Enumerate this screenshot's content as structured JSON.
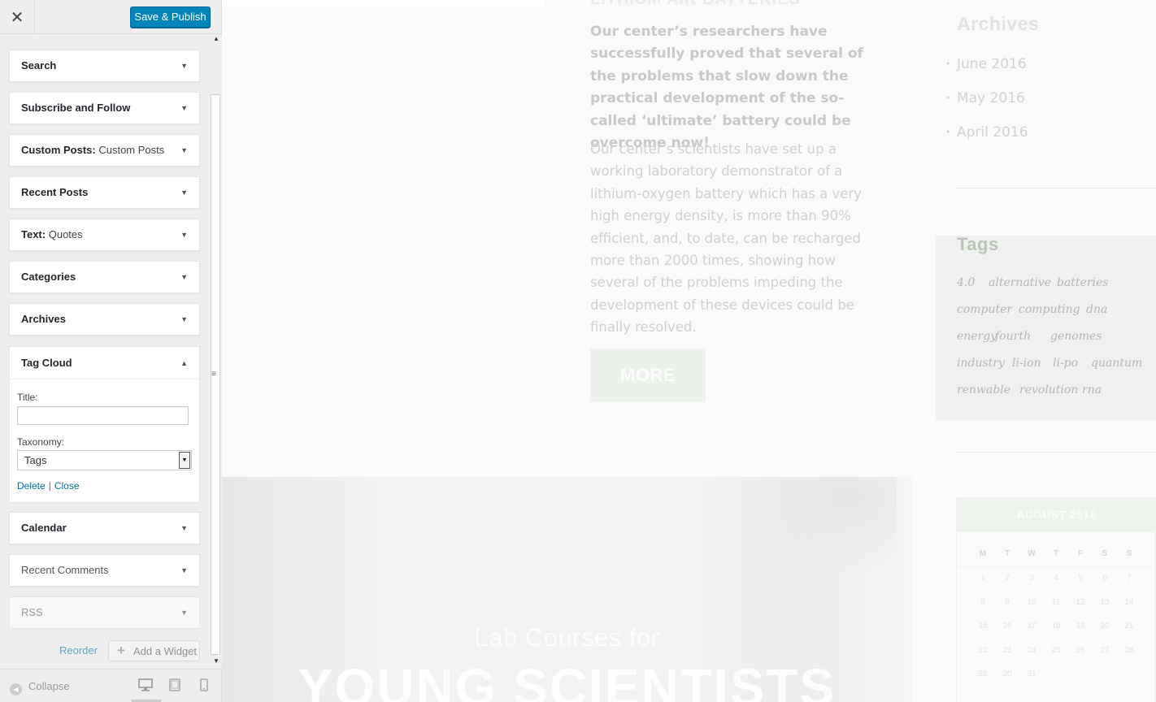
{
  "customizer": {
    "close_icon": "close-icon",
    "save_label": "Save & Publish",
    "widgets": [
      {
        "title": "Search",
        "subtitle": ""
      },
      {
        "title": "Subscribe and Follow",
        "subtitle": ""
      },
      {
        "title": "Custom Posts:",
        "subtitle": " Custom Posts"
      },
      {
        "title": "Recent Posts",
        "subtitle": ""
      },
      {
        "title": "Text:",
        "subtitle": " Quotes"
      },
      {
        "title": "Categories",
        "subtitle": ""
      },
      {
        "title": "Archives",
        "subtitle": ""
      }
    ],
    "tag_cloud": {
      "title": "Tag Cloud",
      "title_label": "Title:",
      "title_value": "",
      "taxonomy_label": "Taxonomy:",
      "taxonomy_value": "Tags",
      "delete_label": "Delete",
      "separator": "|",
      "close_label": "Close"
    },
    "widgets_after": [
      {
        "title": "Calendar"
      },
      {
        "title": "Recent Comments"
      },
      {
        "title": "RSS"
      }
    ],
    "reorder_label": "Reorder",
    "add_widget_label": "Add a Widget",
    "collapse_label": "Collapse",
    "devices": [
      "desktop",
      "tablet",
      "mobile"
    ],
    "active_device": "desktop"
  },
  "preview": {
    "article_heading": "LITHIUM AIR BATTERIES",
    "intro": "Our center’s researchers have successfully proved that several of the problems that slow down the practical development of the so-called ‘ultimate’ battery could be overcome now!",
    "body": "Our center’s scientists have set up a working laboratory demonstrator of a lithium-oxygen battery which has a very high energy density, is more than 90% efficient, and, to date, can be recharged more than 2000 times, showing how several of the problems impeding the development of these devices could be finally resolved.",
    "more_label": "MORE",
    "banner_line1": "Lab Courses for",
    "banner_line2": "YOUNG SCIENTISTS",
    "archives_title": "Archives",
    "archives": [
      "June 2016",
      "May 2016",
      "April 2016"
    ],
    "tags_title": "Tags",
    "tags": [
      "4.0",
      "alternative",
      "batteries",
      "computer",
      "computing",
      "dna",
      "energy",
      "fourth",
      "genomes",
      "industry",
      "li-ion",
      "li-po",
      "quantum",
      "renwable",
      "revolution",
      "rna"
    ],
    "calendar": {
      "month": "AUGUST 2016",
      "day_names": [
        "M",
        "T",
        "W",
        "T",
        "F",
        "S",
        "S"
      ],
      "days": [
        "1",
        "2",
        "3",
        "4",
        "5",
        "6",
        "7",
        "8",
        "9",
        "10",
        "11",
        "12",
        "13",
        "14",
        "15",
        "16",
        "17",
        "18",
        "19",
        "20",
        "21",
        "22",
        "23",
        "24",
        "25",
        "26",
        "27",
        "28",
        "29",
        "30",
        "31"
      ]
    },
    "colors": {
      "accent_green": "#b9c6b6",
      "button_blue": "#0085ba"
    }
  }
}
